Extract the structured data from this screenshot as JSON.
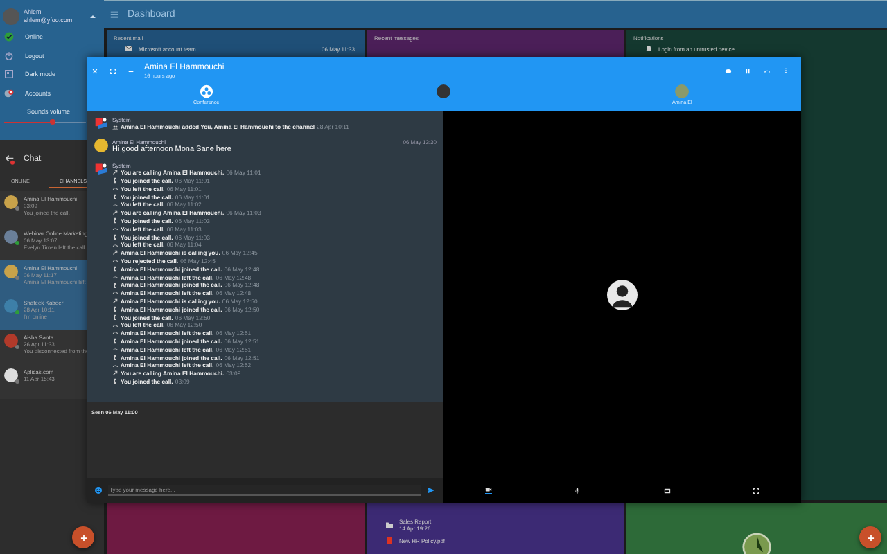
{
  "sidebar": {
    "user": {
      "name": "Ahlem",
      "email": "ahlem@yfoo.com"
    },
    "menu": [
      {
        "label": "Online",
        "kind": "online"
      },
      {
        "label": "Logout",
        "kind": "logout"
      },
      {
        "label": "Dark mode",
        "kind": "dark"
      },
      {
        "label": "Accounts",
        "kind": "accounts"
      }
    ],
    "volume": {
      "label": "Sounds volume",
      "level": 0.6
    },
    "chat": {
      "title": "Chat",
      "tabs": [
        {
          "label": "ONLINE",
          "selected": false
        },
        {
          "label": "CHANNELS",
          "selected": true
        }
      ],
      "conversations": [
        {
          "name": "Amina El Hammouchi",
          "time": "03:09",
          "preview": "You joined the call.",
          "selected": false,
          "online": false
        },
        {
          "name": "Webinar Online Marketing",
          "time": "06 May 13:07",
          "preview": "Evelyn Timen left the call.",
          "selected": false,
          "online": true
        },
        {
          "name": "Amina El Hammouchi",
          "time": "06 May 11:17",
          "preview": "Amina El Hammouchi left",
          "selected": true,
          "online": false
        },
        {
          "name": "Shafeek Kabeer",
          "time": "28 Apr 10:11",
          "preview": "I'm online",
          "selected": true,
          "online": true
        },
        {
          "name": "Aisha Santa",
          "time": "26 Apr 11:33",
          "preview": "You disconnected from the",
          "selected": false,
          "online": false
        },
        {
          "name": "Aplicas.com",
          "time": "11 Apr 15:43",
          "selected": false,
          "online": false
        }
      ]
    }
  },
  "dashboard": {
    "title": "Dashboard",
    "cards": [
      {
        "title": "Recent mail",
        "color": "#1f4f77",
        "items": [
          {
            "title": "Microsoft account team",
            "time": "06 May 11:33",
            "kind": "mail"
          }
        ]
      },
      {
        "title": "Recent messages",
        "color": "#4b1f58"
      },
      {
        "title": "Notifications",
        "color": "#14382f",
        "items": [
          {
            "title": "Login from an untrusted device",
            "kind": "notice"
          }
        ]
      },
      {
        "color": "#6e1a42"
      },
      {
        "color": "#3c2a74",
        "items": [
          {
            "title": "Sales Report",
            "time": "14 Apr 19:26",
            "kind": "folder"
          },
          {
            "title": "New HR Policy.pdf",
            "kind": "file"
          }
        ]
      },
      {
        "color": "#2d6a38",
        "items": [
          {
            "kind": "clock"
          }
        ]
      }
    ]
  },
  "window": {
    "title": "Amina El Hammouchi",
    "subtitle": "16 hours ago",
    "participants": [
      {
        "label": "Conference",
        "kind": "conference"
      },
      {
        "kind": "avatar"
      },
      {
        "label": "Amina El",
        "kind": "avatar"
      }
    ],
    "messages": [
      {
        "kind": "system",
        "sender": "System",
        "lines": [
          {
            "kind": "added",
            "text": "Amina El Hammouchi added You, Amina El Hammouchi to the channel",
            "time": "28 Apr 10:11"
          }
        ]
      },
      {
        "kind": "user",
        "sender": "Amina El Hammouchi",
        "time": "06 May 13:30",
        "text": "Hi good afternoon Mona Sane here"
      },
      {
        "kind": "system",
        "sender": "System",
        "lines": [
          {
            "kind": "calling",
            "text": "You are calling Amina El Hammouchi.",
            "time": "06 May 11:01"
          },
          {
            "kind": "joined",
            "text": "You joined the call.",
            "time": "06 May 11:01"
          },
          {
            "kind": "left",
            "text": "You left the call.",
            "time": "06 May 11:01"
          },
          {
            "kind": "joined",
            "text": "You joined the call.",
            "time": "06 May 11:01"
          },
          {
            "kind": "left",
            "text": "You left the call.",
            "time": "06 May 11:02"
          },
          {
            "kind": "calling",
            "text": "You are calling Amina El Hammouchi.",
            "time": "06 May 11:03"
          },
          {
            "kind": "joined",
            "text": "You joined the call.",
            "time": "06 May 11:03"
          },
          {
            "kind": "left",
            "text": "You left the call.",
            "time": "06 May 11:03"
          },
          {
            "kind": "joined",
            "text": "You joined the call.",
            "time": "06 May 11:03"
          },
          {
            "kind": "left",
            "text": "You left the call.",
            "time": "06 May 11:04"
          },
          {
            "kind": "calling",
            "text": "Amina El Hammouchi is calling you.",
            "time": "06 May 12:45"
          },
          {
            "kind": "left",
            "text": "You rejected the call.",
            "time": "06 May 12:45"
          },
          {
            "kind": "joined",
            "text": "Amina El Hammouchi joined the call.",
            "time": "06 May 12:48"
          },
          {
            "kind": "left",
            "text": "Amina El Hammouchi left the call.",
            "time": "06 May 12:48"
          },
          {
            "kind": "joined",
            "text": "Amina El Hammouchi joined the call.",
            "time": "06 May 12:48"
          },
          {
            "kind": "left",
            "text": "Amina El Hammouchi left the call.",
            "time": "06 May 12:48"
          },
          {
            "kind": "calling",
            "text": "Amina El Hammouchi is calling you.",
            "time": "06 May 12:50"
          },
          {
            "kind": "joined",
            "text": "Amina El Hammouchi joined the call.",
            "time": "06 May 12:50"
          },
          {
            "kind": "joined",
            "text": "You joined the call.",
            "time": "06 May 12:50"
          },
          {
            "kind": "left",
            "text": "You left the call.",
            "time": "06 May 12:50"
          },
          {
            "kind": "left",
            "text": "Amina El Hammouchi left the call.",
            "time": "06 May 12:51"
          },
          {
            "kind": "joined",
            "text": "Amina El Hammouchi joined the call.",
            "time": "06 May 12:51"
          },
          {
            "kind": "left",
            "text": "Amina El Hammouchi left the call.",
            "time": "06 May 12:51"
          },
          {
            "kind": "joined",
            "text": "Amina El Hammouchi joined the call.",
            "time": "06 May 12:51"
          },
          {
            "kind": "left",
            "text": "Amina El Hammouchi left the call.",
            "time": "06 May 12:52"
          },
          {
            "kind": "calling",
            "text": "You are calling Amina El Hammouchi.",
            "time": "03:09"
          },
          {
            "kind": "joined",
            "text": "You joined the call.",
            "time": "03:09"
          }
        ]
      }
    ],
    "seen": "Seen 06 May 11:00",
    "input": {
      "placeholder": "Type your message here..."
    },
    "video_controls": [
      {
        "kind": "camera"
      },
      {
        "kind": "mic"
      },
      {
        "kind": "screen"
      },
      {
        "kind": "fullscreen"
      }
    ]
  }
}
